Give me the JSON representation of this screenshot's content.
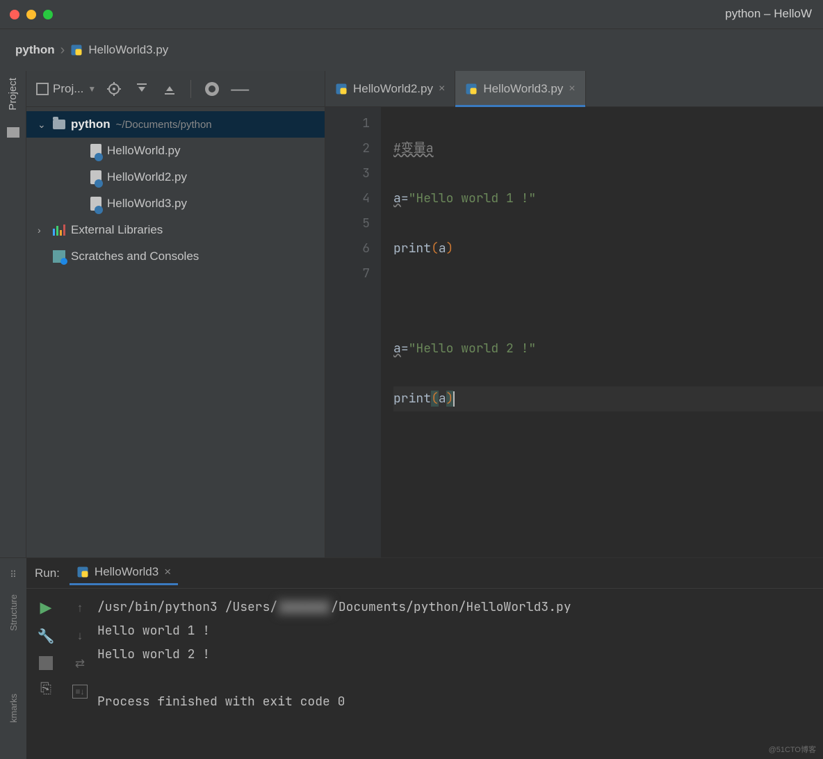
{
  "window": {
    "title": "python – HelloW"
  },
  "breadcrumbs": {
    "root": "python",
    "file": "HelloWorld3.py"
  },
  "sidebar": {
    "project_label": "Proj...",
    "root": {
      "name": "python",
      "path": "~/Documents/python"
    },
    "files": [
      {
        "name": "HelloWorld.py"
      },
      {
        "name": "HelloWorld2.py"
      },
      {
        "name": "HelloWorld3.py"
      }
    ],
    "external_libraries": "External Libraries",
    "scratches": "Scratches and Consoles"
  },
  "left_tool": {
    "project": "Project"
  },
  "tabs": [
    {
      "label": "HelloWorld2.py",
      "active": false
    },
    {
      "label": "HelloWorld3.py",
      "active": true
    }
  ],
  "editor": {
    "lines": [
      "1",
      "2",
      "3",
      "4",
      "5",
      "6",
      "7"
    ],
    "code": {
      "l1_comment": "#变量a",
      "l2_var": "a",
      "l2_eq": "=",
      "l2_str": "\"Hello world 1 !\"",
      "l3_fn": "print",
      "l3_open": "(",
      "l3_arg": "a",
      "l3_close": ")",
      "l5_var": "a",
      "l5_eq": "=",
      "l5_str": "\"Hello world 2 !\"",
      "l6_fn": "print",
      "l6_open": "(",
      "l6_arg": "a",
      "l6_close": ")"
    }
  },
  "run": {
    "label": "Run:",
    "tab": "HelloWorld3",
    "cmd_prefix": "/usr/bin/python3 /Users/",
    "cmd_suffix": "/Documents/python/HelloWorld3.py",
    "out1": "Hello world 1 !",
    "out2": "Hello world 2 !",
    "exit": "Process finished with exit code 0"
  },
  "bottom_rail": {
    "structure": "Structure",
    "bookmarks": "kmarks"
  },
  "watermark": "@51CTO博客"
}
